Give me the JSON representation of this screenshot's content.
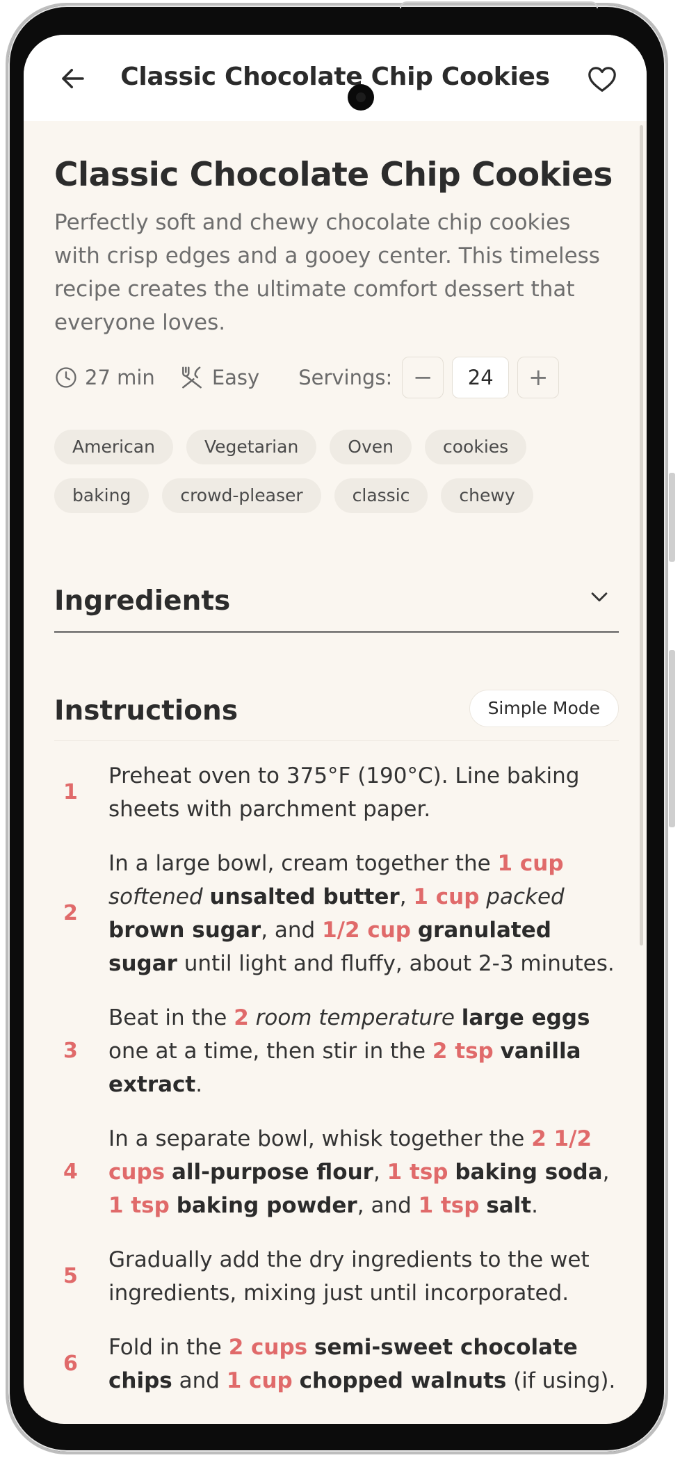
{
  "header": {
    "title": "Classic Chocolate Chip Cookies"
  },
  "recipe": {
    "title": "Classic Chocolate Chip Cookies",
    "description": "Perfectly soft and chewy chocolate chip cookies with crisp edges and a gooey center. This timeless recipe creates the ultimate comfort dessert that everyone loves.",
    "time": "27 min",
    "difficulty": "Easy",
    "servings_label": "Servings:",
    "servings_value": "24",
    "decrement": "−",
    "increment": "+"
  },
  "tags": [
    "American",
    "Vegetarian",
    "Oven",
    "cookies",
    "baking",
    "crowd-pleaser",
    "classic",
    "chewy"
  ],
  "ingredients": {
    "title": "Ingredients"
  },
  "instructions": {
    "title": "Instructions",
    "mode_label": "Simple Mode",
    "steps": [
      {
        "num": "1",
        "segments": [
          {
            "t": "Preheat oven to 375°F (190°C). Line baking sheets with parchment paper.",
            "s": "plain"
          }
        ]
      },
      {
        "num": "2",
        "segments": [
          {
            "t": "In a large bowl, cream together the ",
            "s": "plain"
          },
          {
            "t": "1 cup",
            "s": "q"
          },
          {
            "t": " ",
            "s": "plain"
          },
          {
            "t": "softened",
            "s": "mod"
          },
          {
            "t": " ",
            "s": "plain"
          },
          {
            "t": "unsalted butter",
            "s": "ing"
          },
          {
            "t": ", ",
            "s": "plain"
          },
          {
            "t": "1 cup",
            "s": "q"
          },
          {
            "t": " ",
            "s": "plain"
          },
          {
            "t": "packed",
            "s": "mod"
          },
          {
            "t": " ",
            "s": "plain"
          },
          {
            "t": "brown sugar",
            "s": "ing"
          },
          {
            "t": ", and ",
            "s": "plain"
          },
          {
            "t": "1/2 cup",
            "s": "q"
          },
          {
            "t": " ",
            "s": "plain"
          },
          {
            "t": "granulated sugar",
            "s": "ing"
          },
          {
            "t": " until light and fluffy, about 2-3 minutes.",
            "s": "plain"
          }
        ]
      },
      {
        "num": "3",
        "segments": [
          {
            "t": "Beat in the ",
            "s": "plain"
          },
          {
            "t": "2",
            "s": "q"
          },
          {
            "t": " ",
            "s": "plain"
          },
          {
            "t": "room temperature",
            "s": "mod"
          },
          {
            "t": " ",
            "s": "plain"
          },
          {
            "t": "large eggs",
            "s": "ing"
          },
          {
            "t": " one at a time, then stir in the ",
            "s": "plain"
          },
          {
            "t": "2 tsp",
            "s": "q"
          },
          {
            "t": " ",
            "s": "plain"
          },
          {
            "t": "vanilla extract",
            "s": "ing"
          },
          {
            "t": ".",
            "s": "plain"
          }
        ]
      },
      {
        "num": "4",
        "segments": [
          {
            "t": "In a separate bowl, whisk together the ",
            "s": "plain"
          },
          {
            "t": "2 1/2 cups",
            "s": "q"
          },
          {
            "t": " ",
            "s": "plain"
          },
          {
            "t": "all-purpose flour",
            "s": "ing"
          },
          {
            "t": ", ",
            "s": "plain"
          },
          {
            "t": "1 tsp",
            "s": "q"
          },
          {
            "t": " ",
            "s": "plain"
          },
          {
            "t": "baking soda",
            "s": "ing"
          },
          {
            "t": ", ",
            "s": "plain"
          },
          {
            "t": "1 tsp",
            "s": "q"
          },
          {
            "t": " ",
            "s": "plain"
          },
          {
            "t": "baking powder",
            "s": "ing"
          },
          {
            "t": ", and ",
            "s": "plain"
          },
          {
            "t": "1 tsp",
            "s": "q"
          },
          {
            "t": " ",
            "s": "plain"
          },
          {
            "t": "salt",
            "s": "ing"
          },
          {
            "t": ".",
            "s": "plain"
          }
        ]
      },
      {
        "num": "5",
        "segments": [
          {
            "t": "Gradually add the dry ingredients to the wet ingredients, mixing just until incorporated.",
            "s": "plain"
          }
        ]
      },
      {
        "num": "6",
        "segments": [
          {
            "t": "Fold in the ",
            "s": "plain"
          },
          {
            "t": "2 cups",
            "s": "q"
          },
          {
            "t": " ",
            "s": "plain"
          },
          {
            "t": "semi-sweet chocolate chips",
            "s": "ing"
          },
          {
            "t": " and ",
            "s": "plain"
          },
          {
            "t": "1 cup",
            "s": "q"
          },
          {
            "t": " ",
            "s": "plain"
          },
          {
            "t": "chopped walnuts",
            "s": "ing"
          },
          {
            "t": " (if using).",
            "s": "plain"
          }
        ]
      }
    ]
  },
  "icons": {
    "back": "arrow-left-icon",
    "favorite": "heart-icon",
    "time": "clock-icon",
    "difficulty": "utensils-icon",
    "expand": "chevron-down-icon"
  },
  "colors": {
    "accent": "#e06a6a",
    "background": "#faf6f0",
    "tag_bg": "#efebe4"
  }
}
